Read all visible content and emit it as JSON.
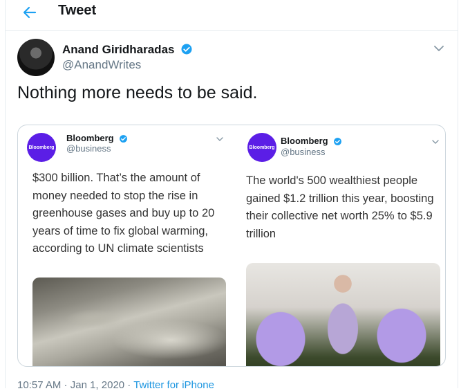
{
  "header": {
    "title": "Tweet",
    "back_icon": "arrow-left-icon"
  },
  "colors": {
    "accent": "#1da1f2",
    "bloomberg": "#5b1ee6"
  },
  "author": {
    "name": "Anand Giridharadas",
    "handle": "@AnandWrites"
  },
  "tweet": {
    "text": "Nothing more needs to be said."
  },
  "quotes": [
    {
      "logo_text": "Bloomberg",
      "name": "Bloomberg",
      "handle": "@business",
      "text": "$300 billion. That’s the amount of money needed to stop the rise in greenhouse gases and buy up to 20 years of time to fix global warming, according to UN climate scientists"
    },
    {
      "logo_text": "Bloomberg",
      "name": "Bloomberg",
      "handle": "@business",
      "text": "The world's 500 wealthiest people gained $1.2 trillion this year, boosting their collective net worth 25% to $5.9 trillion"
    }
  ],
  "footer": {
    "time": "10:57 AM",
    "sep": " · ",
    "date": "Jan 1, 2020",
    "source": "Twitter for iPhone"
  }
}
